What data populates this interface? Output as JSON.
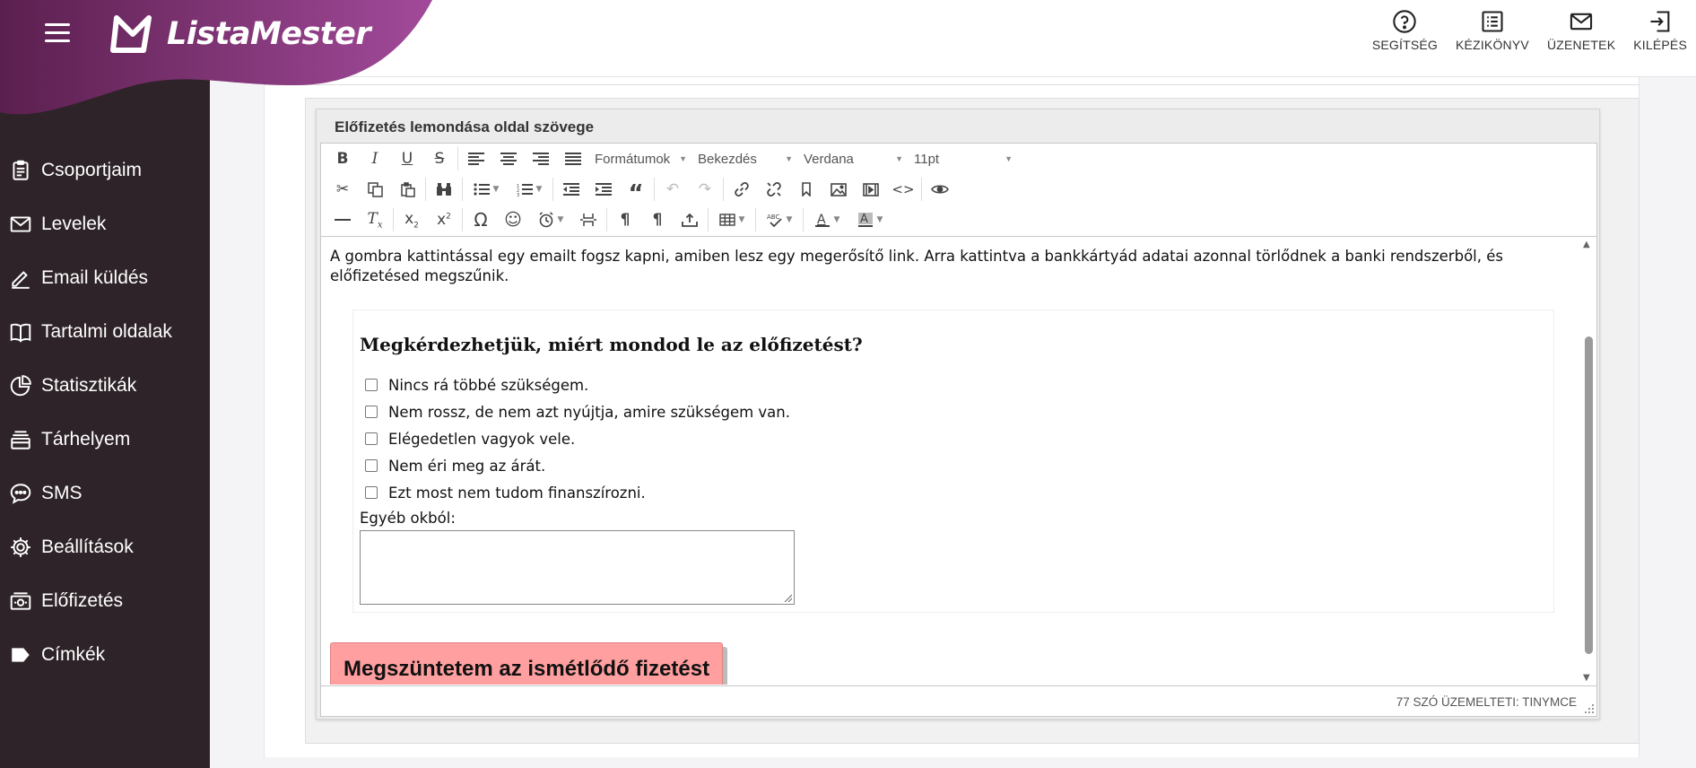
{
  "header": {
    "brand": "ListaMester",
    "actions": [
      {
        "label": "SEGÍTSÉG",
        "icon": "help-circle-icon"
      },
      {
        "label": "KÉZIKÖNYV",
        "icon": "manual-icon"
      },
      {
        "label": "ÜZENETEK",
        "icon": "mail-icon"
      },
      {
        "label": "KILÉPÉS",
        "icon": "logout-icon"
      }
    ]
  },
  "sidebar": {
    "items": [
      {
        "label": "Csoportjaim",
        "icon": "clipboard-icon"
      },
      {
        "label": "Levelek",
        "icon": "envelope-icon"
      },
      {
        "label": "Email küldés",
        "icon": "pencil-icon"
      },
      {
        "label": "Tartalmi oldalak",
        "icon": "book-icon"
      },
      {
        "label": "Statisztikák",
        "icon": "pie-chart-icon"
      },
      {
        "label": "Tárhelyem",
        "icon": "storage-icon"
      },
      {
        "label": "SMS",
        "icon": "chat-bubble-icon"
      },
      {
        "label": "Beállítások",
        "icon": "gear-icon"
      },
      {
        "label": "Előfizetés",
        "icon": "subscription-icon"
      },
      {
        "label": "Címkék",
        "icon": "tag-icon"
      }
    ]
  },
  "editor": {
    "section_title": "Előfizetés lemondása oldal szövege",
    "toolbar": {
      "formats": "Formátumok",
      "block": "Bekezdés",
      "font": "Verdana",
      "size": "11pt"
    },
    "content": {
      "intro": "A gombra kattintással egy emailt fogsz kapni, amiben lesz egy megerősítő link. Arra kattintva a bankkártyád adatai azonnal törlődnek a banki rendszerből, és előfizetésed megszűnik.",
      "question": "Megkérdezhetjük, miért mondod le az előfizetést?",
      "options": [
        "Nincs rá többé szükségem.",
        "Nem rossz, de nem azt nyújtja, amire szükségem van.",
        "Elégedetlen vagyok vele.",
        "Nem éri meg az árát.",
        "Ezt most nem tudom finanszírozni."
      ],
      "other_label": "Egyéb okból:",
      "cancel_button": "Megszüntetem az ismétlődő fizetést"
    },
    "status": "77 SZÓ ÜZEMELTETI: TINYMCE"
  },
  "colors": {
    "sidebar_bg": "#2e2328",
    "brand_gradient_start": "#5b1f4e",
    "brand_gradient_end": "#a24a9a",
    "cancel_button_bg": "#ff9f9f"
  }
}
